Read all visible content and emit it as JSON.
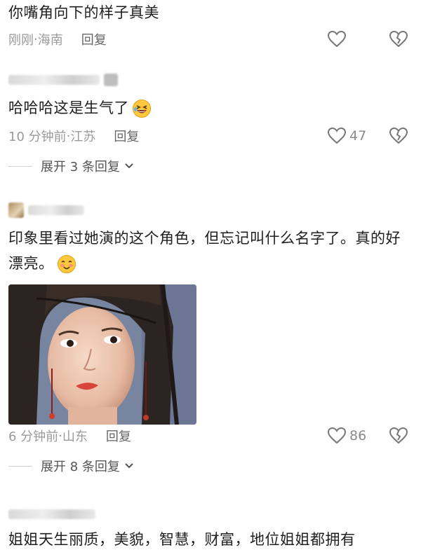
{
  "comments": [
    {
      "text": "你嘴角向下的样子真美",
      "time": "刚刚",
      "location": "海南",
      "reply_label": "回复"
    },
    {
      "text": "哈哈哈这是生气了",
      "time": "10 分钟前",
      "location": "江苏",
      "reply_label": "回复",
      "likes": "47",
      "expand_label": "展开 3 条回复"
    },
    {
      "text": "印象里看过她演的这个角色，但忘记叫什么名字了。真的好漂亮。",
      "time": "6 分钟前",
      "location": "山东",
      "reply_label": "回复",
      "likes": "86",
      "expand_label": "展开 8 条回复"
    },
    {
      "text": "姐姐天生丽质，美貌，智慧，财富，地位姐姐都拥有"
    }
  ],
  "meta_sep": " · ",
  "icons": {
    "like": "heart-outline-icon",
    "dislike": "broken-heart-outline-icon",
    "expand": "chevron-down-icon",
    "emoji_laugh": "laughing-emoji-icon",
    "emoji_blush": "blushing-emoji-icon"
  }
}
